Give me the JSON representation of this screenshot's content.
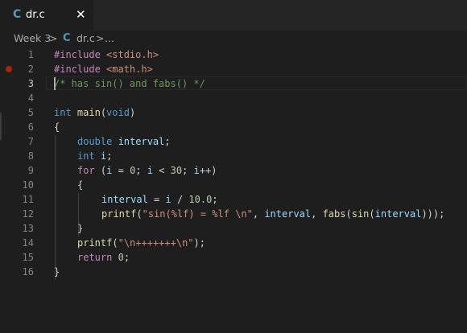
{
  "tab": {
    "icon": "C",
    "label": "dr.c",
    "close": "✕"
  },
  "breadcrumb": {
    "folder": "Week 3",
    "sep1": ">",
    "file_icon": "C",
    "file": "dr.c",
    "sep2": ">",
    "more": "..."
  },
  "editor": {
    "line_numbers": [
      "1",
      "2",
      "3",
      "4",
      "5",
      "6",
      "7",
      "8",
      "9",
      "10",
      "11",
      "12",
      "13",
      "14",
      "15",
      "16"
    ],
    "breakpoint_line": 2,
    "active_line": 3,
    "code": {
      "l1": {
        "kw": "#include",
        "str": " <stdio.h>"
      },
      "l2": {
        "kw": "#include",
        "str": " <math.h>"
      },
      "l3": {
        "comment": "/* has sin() and fabs() */"
      },
      "l5": {
        "type": "int",
        "fn": " main",
        "p1": "(",
        "kw": "void",
        "p2": ")"
      },
      "l6": {
        "text": "{"
      },
      "l7": {
        "type": "double",
        "var": " interval",
        "p": ";"
      },
      "l8": {
        "type": "int",
        "var": " i",
        "p": ";"
      },
      "l9": {
        "kw": "for",
        "p1": " (",
        "v1": "i",
        "op": " = ",
        "n1": "0",
        "p2": "; ",
        "v2": "i",
        "op2": " < ",
        "n2": "30",
        "p3": "; ",
        "v3": "i",
        "op3": "++)"
      },
      "l10": {
        "text": "{"
      },
      "l11": {
        "v1": "interval",
        "op": " = ",
        "v2": "i",
        "op2": " / ",
        "n": "10.0",
        "p": ";"
      },
      "l12": {
        "fn": "printf",
        "p1": "(",
        "str": "\"sin(%lf) = %lf \\n\"",
        "p2": ", ",
        "v1": "interval",
        "p3": ", ",
        "fn2": "fabs",
        "p4": "(",
        "fn3": "sin",
        "p5": "(",
        "v2": "interval",
        "p6": ")));"
      },
      "l13": {
        "text": "}"
      },
      "l14": {
        "fn": "printf",
        "p1": "(",
        "str": "\"\\n+++++++\\n\"",
        "p2": ");"
      },
      "l15": {
        "kw": "return",
        "n": " 0",
        "p": ";"
      },
      "l16": {
        "text": "}"
      }
    }
  },
  "colors": {
    "background": "#1e1e1e",
    "tab_bar": "#252526",
    "keyword": "#569cd6",
    "preprocessor": "#c586c0",
    "string": "#ce9178",
    "comment": "#6a9955",
    "function": "#dcdcaa",
    "variable": "#9cdcfe",
    "number": "#b5cea8",
    "breakpoint": "#a1260d"
  }
}
